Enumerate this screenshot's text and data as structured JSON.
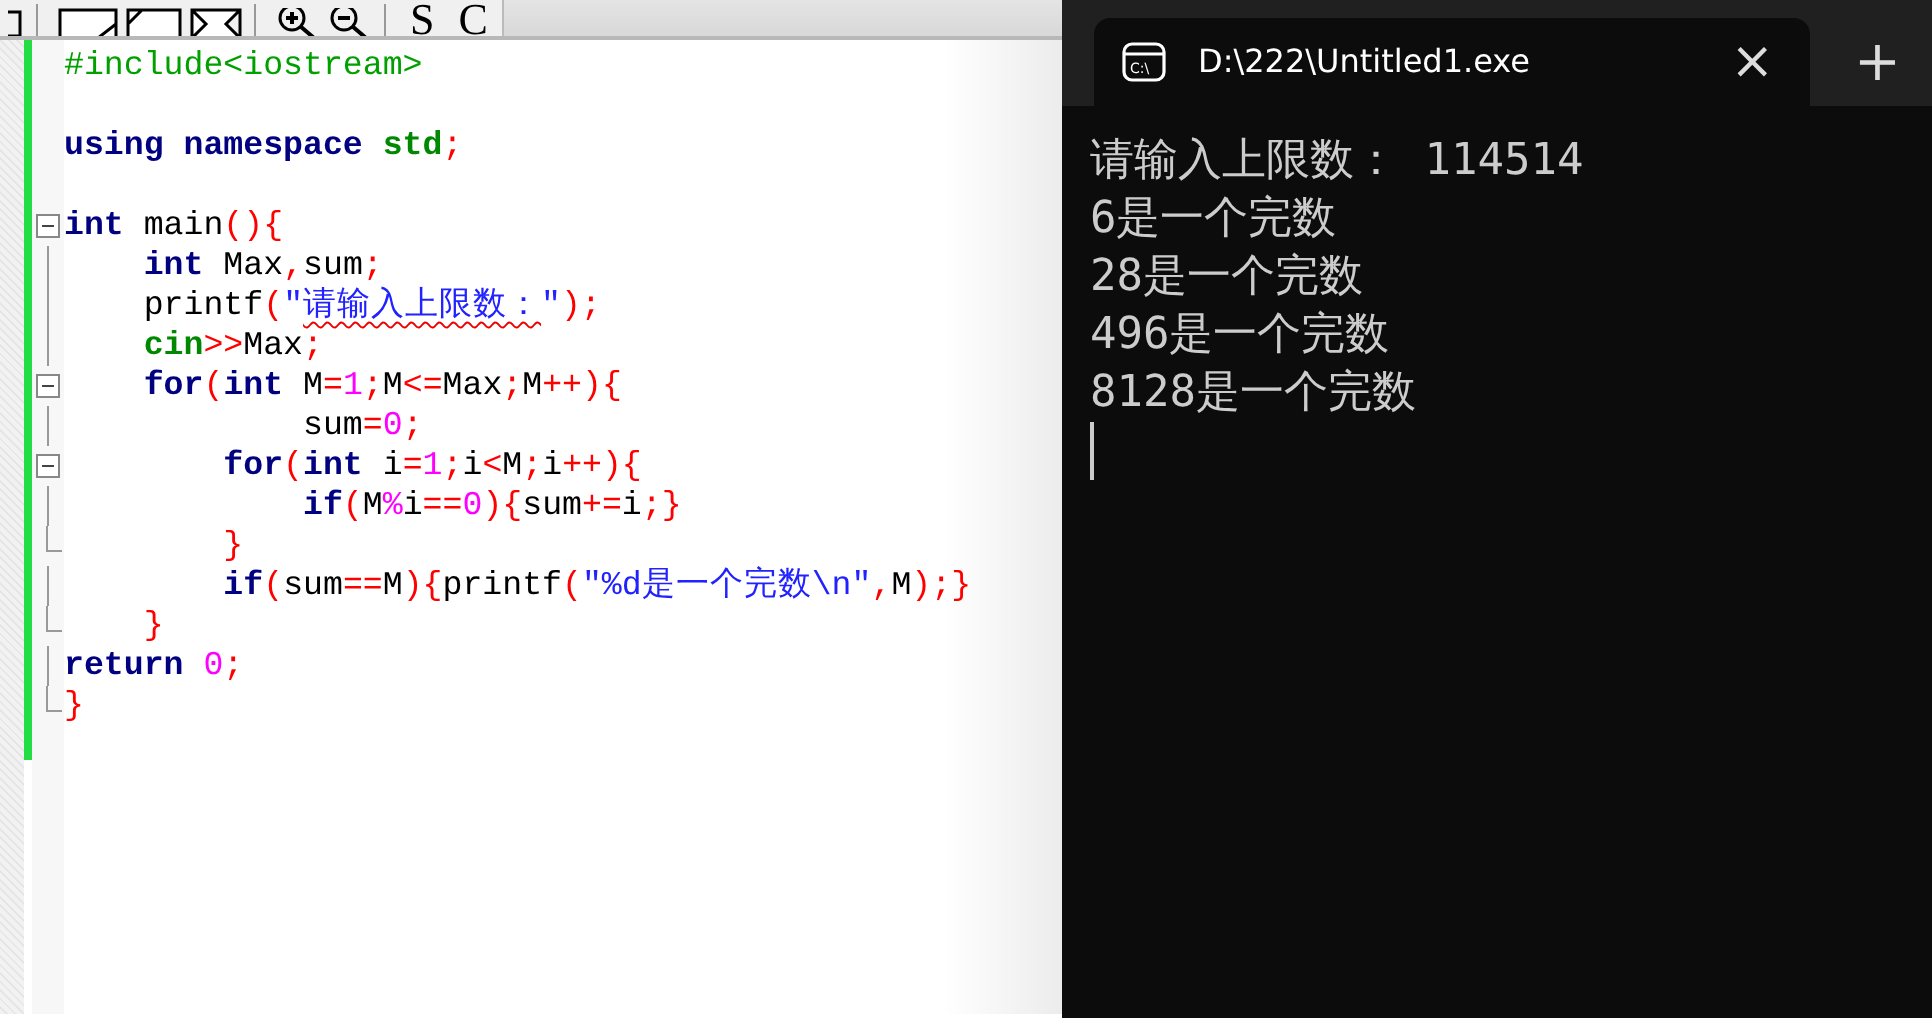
{
  "toolbar": {
    "letters": [
      "S",
      "C"
    ]
  },
  "editor": {
    "lines": [
      {
        "kind": "code",
        "foldable": false,
        "block_end": false,
        "tokens": [
          {
            "text": "#include<iostream>",
            "kind": "pre"
          }
        ]
      },
      {
        "kind": "blank"
      },
      {
        "kind": "code",
        "foldable": false,
        "block_end": false,
        "tokens": [
          {
            "text": "using namespace ",
            "kind": "kw"
          },
          {
            "text": "std",
            "kind": "lib"
          },
          {
            "text": ";",
            "kind": "sym"
          }
        ]
      },
      {
        "kind": "blank"
      },
      {
        "kind": "code",
        "foldable": true,
        "block_end": false,
        "tokens": [
          {
            "text": "int",
            "kind": "kw"
          },
          {
            "text": " main",
            "kind": "plain"
          },
          {
            "text": "(){",
            "kind": "sym"
          }
        ]
      },
      {
        "kind": "code",
        "foldable": false,
        "block_end": false,
        "tokens": [
          {
            "text": "    int",
            "kind": "kw"
          },
          {
            "text": " Max",
            "kind": "plain"
          },
          {
            "text": ",",
            "kind": "sym"
          },
          {
            "text": "sum",
            "kind": "plain"
          },
          {
            "text": ";",
            "kind": "sym"
          }
        ]
      },
      {
        "kind": "code",
        "foldable": false,
        "block_end": false,
        "tokens": [
          {
            "text": "    printf",
            "kind": "plain"
          },
          {
            "text": "(",
            "kind": "sym"
          },
          {
            "text": "\"",
            "kind": "str"
          },
          {
            "text": "请输入上限数：",
            "kind": "str",
            "squiggle": true
          },
          {
            "text": "\"",
            "kind": "str"
          },
          {
            "text": ");",
            "kind": "sym"
          }
        ]
      },
      {
        "kind": "code",
        "foldable": false,
        "block_end": false,
        "tokens": [
          {
            "text": "    cin",
            "kind": "lib"
          },
          {
            "text": ">>",
            "kind": "sym"
          },
          {
            "text": "Max",
            "kind": "plain"
          },
          {
            "text": ";",
            "kind": "sym"
          }
        ]
      },
      {
        "kind": "code",
        "foldable": true,
        "block_end": false,
        "tokens": [
          {
            "text": "    for",
            "kind": "kw"
          },
          {
            "text": "(",
            "kind": "sym"
          },
          {
            "text": "int",
            "kind": "kw"
          },
          {
            "text": " M",
            "kind": "plain"
          },
          {
            "text": "=",
            "kind": "sym"
          },
          {
            "text": "1",
            "kind": "num"
          },
          {
            "text": ";",
            "kind": "sym"
          },
          {
            "text": "M",
            "kind": "plain"
          },
          {
            "text": "<=",
            "kind": "sym"
          },
          {
            "text": "Max",
            "kind": "plain"
          },
          {
            "text": ";",
            "kind": "sym"
          },
          {
            "text": "M",
            "kind": "plain"
          },
          {
            "text": "++){",
            "kind": "sym"
          }
        ]
      },
      {
        "kind": "code",
        "foldable": false,
        "block_end": false,
        "tokens": [
          {
            "text": "            sum",
            "kind": "plain"
          },
          {
            "text": "=",
            "kind": "sym"
          },
          {
            "text": "0",
            "kind": "num"
          },
          {
            "text": ";",
            "kind": "sym"
          }
        ]
      },
      {
        "kind": "code",
        "foldable": true,
        "block_end": false,
        "tokens": [
          {
            "text": "        for",
            "kind": "kw"
          },
          {
            "text": "(",
            "kind": "sym"
          },
          {
            "text": "int",
            "kind": "kw"
          },
          {
            "text": " i",
            "kind": "plain"
          },
          {
            "text": "=",
            "kind": "sym"
          },
          {
            "text": "1",
            "kind": "num"
          },
          {
            "text": ";",
            "kind": "sym"
          },
          {
            "text": "i",
            "kind": "plain"
          },
          {
            "text": "<",
            "kind": "sym"
          },
          {
            "text": "M",
            "kind": "plain"
          },
          {
            "text": ";",
            "kind": "sym"
          },
          {
            "text": "i",
            "kind": "plain"
          },
          {
            "text": "++){",
            "kind": "sym"
          }
        ]
      },
      {
        "kind": "code",
        "foldable": false,
        "block_end": false,
        "tokens": [
          {
            "text": "            if",
            "kind": "kw"
          },
          {
            "text": "(",
            "kind": "sym"
          },
          {
            "text": "M",
            "kind": "plain"
          },
          {
            "text": "%",
            "kind": "num"
          },
          {
            "text": "i",
            "kind": "plain"
          },
          {
            "text": "==",
            "kind": "sym"
          },
          {
            "text": "0",
            "kind": "num"
          },
          {
            "text": "){",
            "kind": "sym"
          },
          {
            "text": "sum",
            "kind": "plain"
          },
          {
            "text": "+=",
            "kind": "sym"
          },
          {
            "text": "i",
            "kind": "plain"
          },
          {
            "text": ";}",
            "kind": "sym"
          }
        ]
      },
      {
        "kind": "code",
        "foldable": false,
        "block_end": true,
        "tokens": [
          {
            "text": "        }",
            "kind": "sym"
          }
        ]
      },
      {
        "kind": "code",
        "foldable": false,
        "block_end": false,
        "tokens": [
          {
            "text": "        if",
            "kind": "kw"
          },
          {
            "text": "(",
            "kind": "sym"
          },
          {
            "text": "sum",
            "kind": "plain"
          },
          {
            "text": "==",
            "kind": "sym"
          },
          {
            "text": "M",
            "kind": "plain"
          },
          {
            "text": "){",
            "kind": "sym"
          },
          {
            "text": "printf",
            "kind": "plain"
          },
          {
            "text": "(",
            "kind": "sym"
          },
          {
            "text": "\"%d是一个完数\\n\"",
            "kind": "str"
          },
          {
            "text": ",",
            "kind": "sym"
          },
          {
            "text": "M",
            "kind": "plain"
          },
          {
            "text": ");}",
            "kind": "sym"
          }
        ]
      },
      {
        "kind": "code",
        "foldable": false,
        "block_end": true,
        "tokens": [
          {
            "text": "    }",
            "kind": "sym"
          }
        ]
      },
      {
        "kind": "code",
        "foldable": false,
        "block_end": false,
        "tokens": [
          {
            "text": "return",
            "kind": "kw"
          },
          {
            "text": " 0",
            "kind": "num"
          },
          {
            "text": ";",
            "kind": "sym"
          }
        ]
      },
      {
        "kind": "code",
        "foldable": false,
        "block_end": true,
        "tokens": [
          {
            "text": "}",
            "kind": "sym"
          }
        ]
      }
    ]
  },
  "terminal": {
    "icon_label": "C:\\",
    "tab_title": "D:\\222\\Untitled1.exe",
    "close": "×",
    "new_tab": "+",
    "output": [
      "请输入上限数： 114514",
      "6是一个完数",
      "28是一个完数",
      "496是一个完数",
      "8128是一个完数"
    ]
  }
}
